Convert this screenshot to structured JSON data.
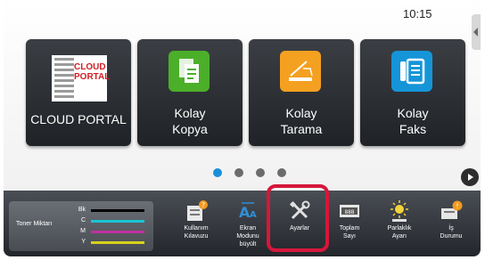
{
  "status": {
    "time": "10:15"
  },
  "tiles": [
    {
      "label": "CLOUD PORTAL",
      "logo_text": "CLOUD\nPORTAL",
      "icon": "cloud-portal-logo",
      "color": "#d21d25"
    },
    {
      "label": "Kolay\nKopya",
      "icon": "copy-icon",
      "color": "#4caf2a"
    },
    {
      "label": "Kolay\nTarama",
      "icon": "scan-icon",
      "color": "#f4a020"
    },
    {
      "label": "Kolay\nFaks",
      "icon": "fax-icon",
      "color": "#1595d8"
    }
  ],
  "pager": {
    "pages": 4,
    "active": 0
  },
  "toner": {
    "title": "Toner Miktarı",
    "channels": [
      {
        "name": "Bk",
        "color": "#000000"
      },
      {
        "name": "C",
        "color": "#19c5d6"
      },
      {
        "name": "M",
        "color": "#c030a0"
      },
      {
        "name": "Y",
        "color": "#d7d21a"
      }
    ]
  },
  "bottom_buttons": [
    {
      "label": "Kullanım\nKılavuzu",
      "icon": "manual-icon"
    },
    {
      "label": "Ekran\nModunu\nbüyült",
      "icon": "enlarge-display-icon"
    },
    {
      "label": "Ayarlar",
      "icon": "settings-tools-icon"
    },
    {
      "label": "Toplam\nSayı",
      "icon": "counter-icon"
    },
    {
      "label": "Parlaklık\nAyarı",
      "icon": "brightness-icon"
    },
    {
      "label": "İş\nDurumu",
      "icon": "job-status-icon"
    }
  ],
  "colors": {
    "highlight": "#d6173a",
    "tile_bg": "#2b2e33",
    "bar_bg": "#2f3237"
  }
}
